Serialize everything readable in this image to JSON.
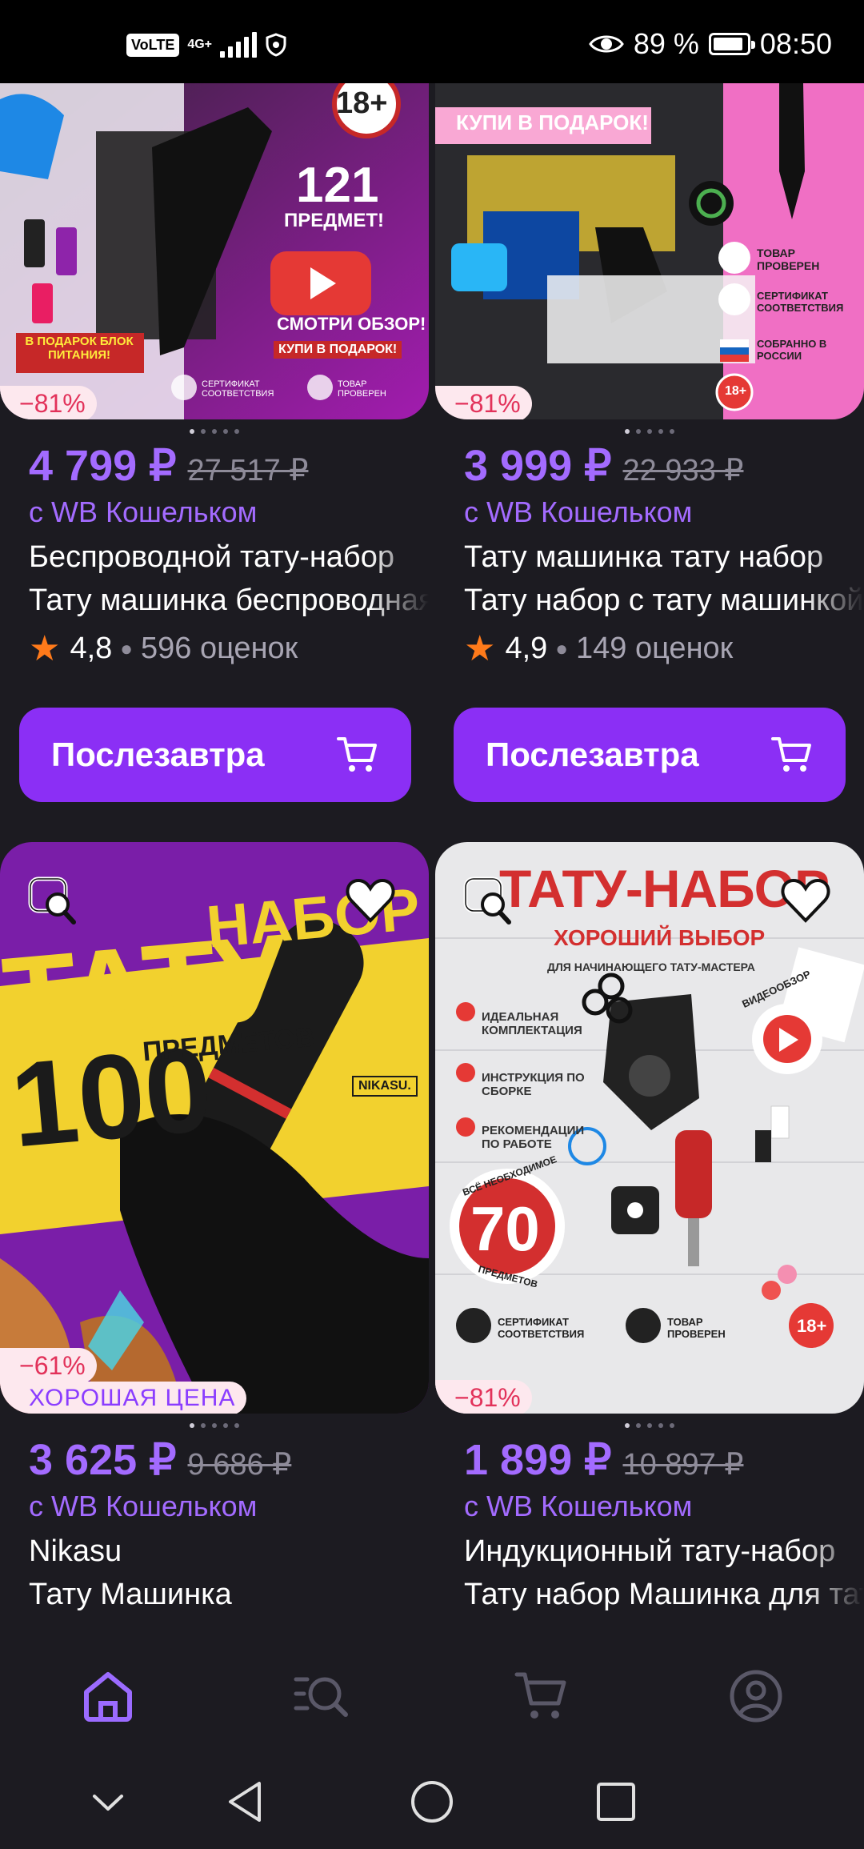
{
  "status_bar": {
    "volte": "VoLTE",
    "network": "4G+",
    "battery_text": "89 %",
    "battery_level": 0.89,
    "time": "08:50"
  },
  "products": [
    {
      "discount": "−81%",
      "price": "4 799 ₽",
      "old_price": "27 517 ₽",
      "wallet": "с WB Кошельком",
      "title_line1": "Беспроводной тату-набор",
      "title_line2": "Тату машинка беспроводная",
      "rating": "4,8",
      "reviews": "596 оценок",
      "button": "Послезавтра",
      "image_text": {
        "age": "18+",
        "count": "121",
        "unit": "ПРЕДМЕТ!",
        "review": "СМОТРИ ОБЗОР!",
        "gift": "КУПИ В ПОДАРОК!",
        "bonus": "В ПОДАРОК БЛОК ПИТАНИЯ!",
        "cert": "СЕРТИФИКАТ СООТВЕТСТВИЯ",
        "checked": "ТОВАР ПРОВЕРЕН"
      }
    },
    {
      "discount": "−81%",
      "price": "3 999 ₽",
      "old_price": "22 933 ₽",
      "wallet": "с WB Кошельком",
      "title_line1": "Тату машинка тату набор",
      "title_line2": "Тату набор с тату машинкой",
      "rating": "4,9",
      "reviews": "149 оценок",
      "button": "Послезавтра",
      "image_text": {
        "gift": "КУПИ В ПОДАРОК!",
        "checked": "ТОВАР ПРОВЕРЕН",
        "cert": "СЕРТИФИКАТ СООТВЕТСТВИЯ",
        "russia": "СОБРАННО В РОССИИ",
        "age": "18+"
      }
    },
    {
      "discount": "−61%",
      "good_price": "ХОРОШАЯ ЦЕНА",
      "price": "3 625 ₽",
      "old_price": "9 686 ₽",
      "wallet": "с WB Кошельком",
      "title_line1": "Nikasu",
      "title_line2": "Тату Машинка",
      "image_text": {
        "headline_a": "ТАТУ",
        "headline_b": "НАБОР",
        "count": "100",
        "unit": "ПРЕДМЕТОВ",
        "brand": "NIKASU."
      }
    },
    {
      "discount": "−81%",
      "price": "1 899 ₽",
      "old_price": "10 897 ₽",
      "wallet": "с WB Кошельком",
      "title_line1": "Индукционный тату-набор",
      "title_line2": "Тату набор Машинка для тату",
      "image_text": {
        "headline": "ТАТУ-НАБОР",
        "sub": "ХОРОШИЙ ВЫБОР",
        "sub2": "ДЛЯ НАЧИНАЮЩЕГО ТАТУ-МАСТЕРА",
        "f1": "ИДЕАЛЬНАЯ КОМПЛЕКТАЦИЯ",
        "f2": "ИНСТРУКЦИЯ ПО СБОРКЕ",
        "f3": "РЕКОМЕНДАЦИИ ПО РАБОТЕ",
        "count": "70",
        "ring_top": "ВСЁ НЕОБХОДИМОЕ",
        "ring_bottom": "ПРЕДМЕТОВ",
        "video": "ВИДЕООБЗОР",
        "cert": "СЕРТИФИКАТ СООТВЕТСТВИЯ",
        "checked": "ТОВАР ПРОВЕРЕН",
        "age": "18+"
      }
    }
  ],
  "colors": {
    "accent": "#8b2ff5",
    "price": "#a36bff",
    "discount": "#e2325a",
    "background": "#1c1b21"
  },
  "tabs": [
    "home-icon",
    "catalog-search-icon",
    "cart-icon",
    "profile-icon"
  ],
  "system_nav": [
    "chevron-down-icon",
    "back-icon",
    "home-circle-icon",
    "recents-icon"
  ]
}
